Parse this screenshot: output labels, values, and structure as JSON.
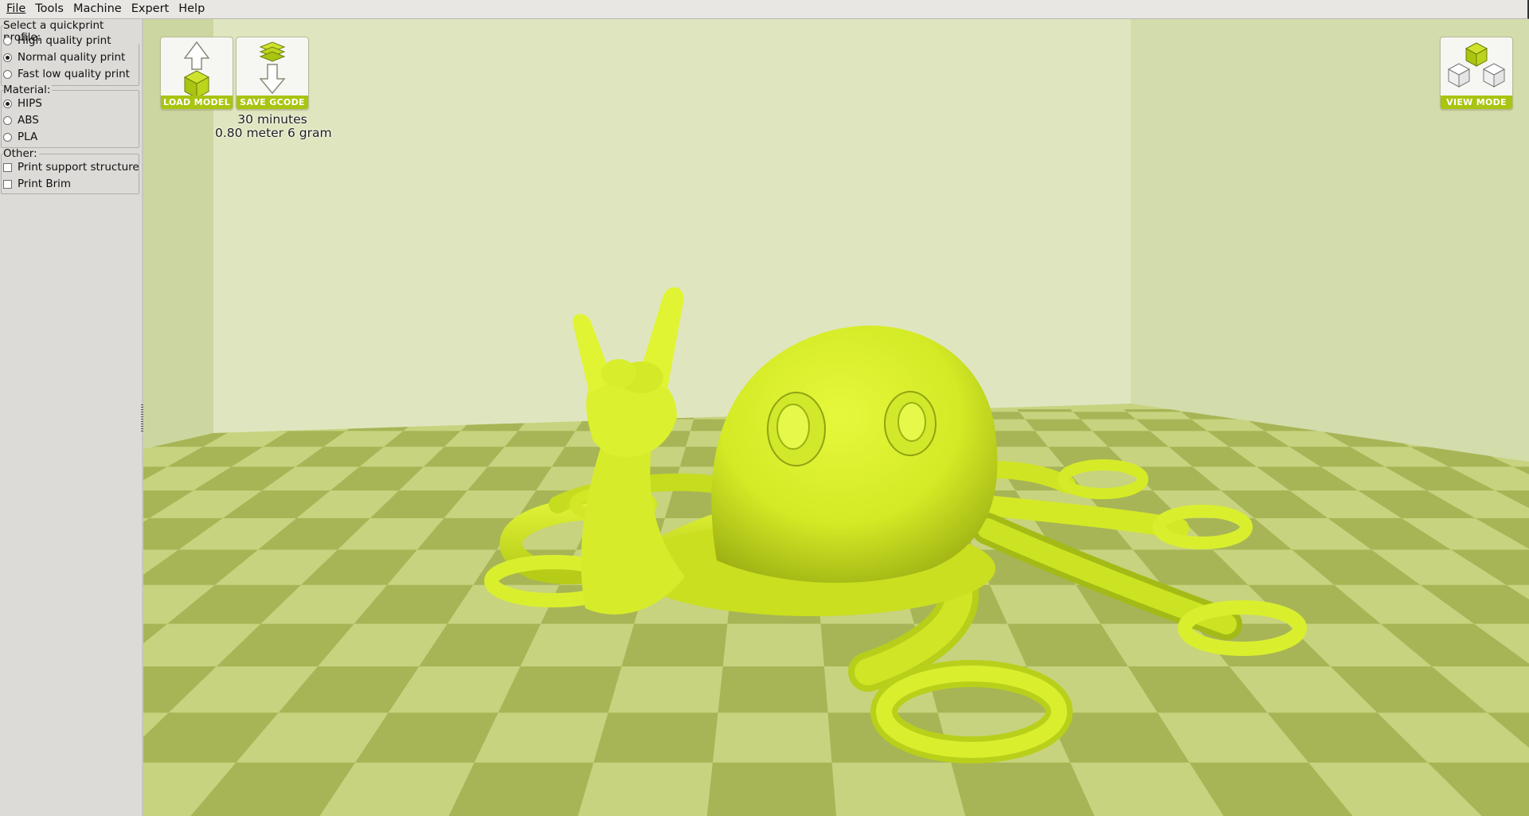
{
  "menu": [
    "File",
    "Tools",
    "Machine",
    "Expert",
    "Help"
  ],
  "sidebar": {
    "profile": {
      "label": "Select a quickprint profile:",
      "options": [
        "High quality print",
        "Normal quality print",
        "Fast low quality print"
      ],
      "selected": "Normal quality print"
    },
    "material": {
      "label": "Material:",
      "options": [
        "HIPS",
        "ABS",
        "PLA"
      ],
      "selected": "HIPS"
    },
    "other": {
      "label": "Other:",
      "options": [
        "Print support structure",
        "Print Brim"
      ],
      "checked": []
    }
  },
  "toolbar": {
    "load_label": "LOAD MODEL",
    "save_label": "SAVE GCODE",
    "view_label": "VIEW MODE"
  },
  "print_info": {
    "time": "30 minutes",
    "material": "0.80 meter 6 gram"
  },
  "colors": {
    "model": "#d9ef2e",
    "accent": "#a9c411",
    "floor_dark": "#a7b556",
    "floor_light": "#c7d37e",
    "wall": "#dfe6bf"
  }
}
